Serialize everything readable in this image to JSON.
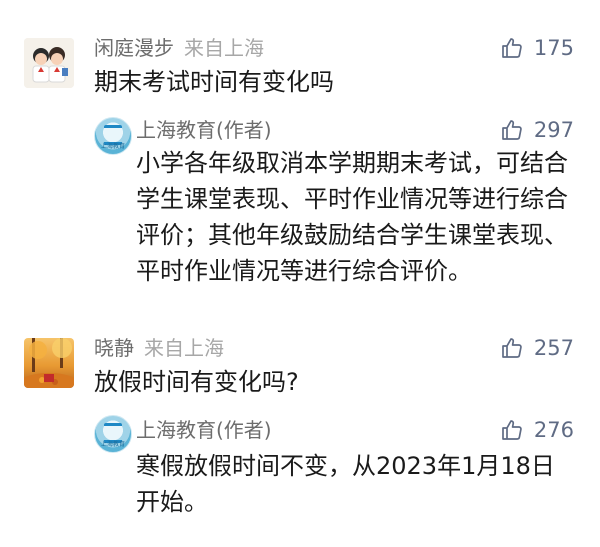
{
  "comments": [
    {
      "user": {
        "name": "闲庭漫步",
        "region": "来自上海",
        "avatar": "cartoon-children-avatar"
      },
      "likes": "175",
      "text": "期末考试时间有变化吗",
      "reply": {
        "author": "上海教育(作者)",
        "avatar": "shanghai-education-logo",
        "avatar_caption": "上海教育",
        "likes": "297",
        "text": "小学各年级取消本学期期末考试，可结合学生课堂表现、平时作业情况等进行综合评价；其他年级鼓励结合学生课堂表现、平时作业情况等进行综合评价。"
      }
    },
    {
      "user": {
        "name": "晓静",
        "region": "来自上海",
        "avatar": "autumn-leaves-avatar"
      },
      "likes": "257",
      "text": "放假时间有变化吗?",
      "reply": {
        "author": "上海教育(作者)",
        "avatar": "shanghai-education-logo",
        "avatar_caption": "上海教育",
        "likes": "276",
        "text": "寒假放假时间不变，从2023年1月18日开始。"
      }
    }
  ],
  "colors": {
    "name": "#6d6d6d",
    "region": "#a7a7a7",
    "like": "#5f6b84",
    "body_text": "#1a1a1a"
  },
  "icons": {
    "like": "thumbs-up-icon"
  }
}
